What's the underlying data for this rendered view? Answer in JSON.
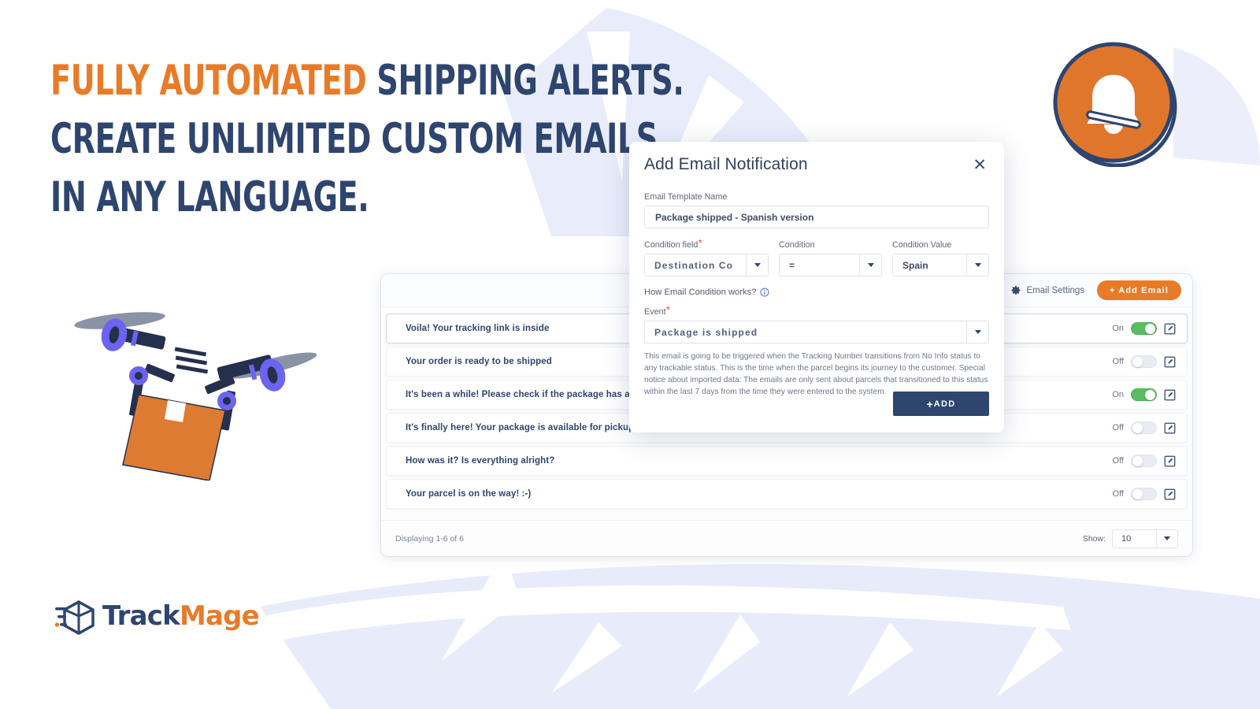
{
  "hero": {
    "line1_highlight": "FULLY AUTOMATED",
    "line1_rest": " SHIPPING ALERTS.",
    "line2": "CREATE UNLIMITED CUSTOM EMAILS,",
    "line3": "IN ANY LANGUAGE.",
    "accent_color": "#e87b28",
    "text_color": "#2e456f"
  },
  "logo": {
    "name_part1": "Track",
    "name_part2": "Mage",
    "icon": "trackmage-cube-icon"
  },
  "badge": {
    "icon": "bell-icon",
    "circle_color": "#e0762c",
    "ring_color": "#2e456f"
  },
  "illustration": {
    "name": "delivery-drone-with-package"
  },
  "panel": {
    "header": {
      "settings_label": "Email Settings",
      "settings_icon": "gear-icon",
      "add_email_label": "+ Add Email",
      "add_email_color": "#e87b28"
    },
    "rows": [
      {
        "title": "Voila! Your tracking link is inside",
        "state": "On",
        "on": true
      },
      {
        "title": "Your order is ready to be shipped",
        "state": "Off",
        "on": false
      },
      {
        "title": "It's been a while! Please check if the package has arrived",
        "state": "On",
        "on": true
      },
      {
        "title": "It's finally here! Your package is available for pickup",
        "state": "Off",
        "on": false
      },
      {
        "title": "How was it? Is everything alright?",
        "state": "Off",
        "on": false
      },
      {
        "title": "Your parcel is on the way! :-)",
        "state": "Off",
        "on": false
      }
    ],
    "footer": {
      "displaying": "Displaying 1-6 of 6",
      "show_label": "Show:",
      "show_value": "10"
    }
  },
  "modal": {
    "title": "Add Email Notification",
    "close_icon": "close-icon",
    "template_name": {
      "label": "Email Template Name",
      "value": "Package shipped - Spanish version"
    },
    "condition_field": {
      "label": "Condition field",
      "required": true,
      "value": "Destination Co"
    },
    "condition": {
      "label": "Condition",
      "required": false,
      "value": "="
    },
    "condition_value": {
      "label": "Condition Value",
      "required": false,
      "value": "Spain"
    },
    "how_works": {
      "text": "How Email Condition works?",
      "icon": "info-icon"
    },
    "event": {
      "label": "Event",
      "required": true,
      "value": "Package is shipped"
    },
    "description": "This email is going to be triggered when the Tracking Number transitions from No Info status to any trackable status. This is the time when the parcel begins its journey to the customer. Special notice about imported data: The emails are only sent about parcels that transitioned to this status within the last 7 days from the time they were entered to the system.",
    "submit_label": "ADD",
    "submit_plus": "+",
    "submit_color": "#2e456f"
  }
}
